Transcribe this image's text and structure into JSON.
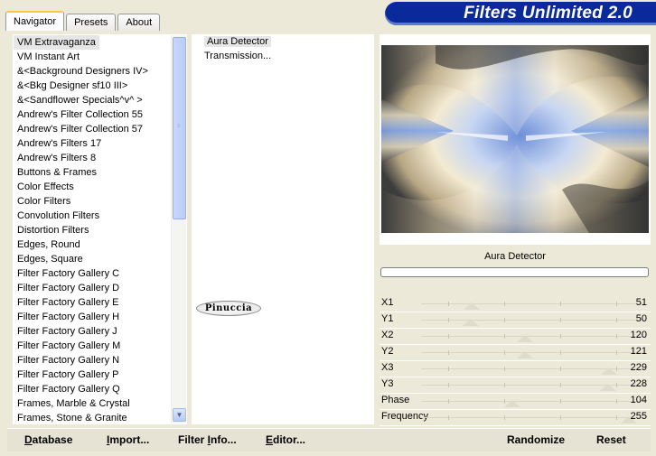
{
  "tabs": [
    {
      "label": "Navigator",
      "active": true
    },
    {
      "label": "Presets",
      "active": false
    },
    {
      "label": "About",
      "active": false
    }
  ],
  "app_title": "Filters Unlimited 2.0",
  "categories": [
    "VM Extravaganza",
    "VM Instant Art",
    "&<Background Designers IV>",
    "&<Bkg Designer sf10 III>",
    "&<Sandflower Specials^v^ >",
    "Andrew's Filter Collection 55",
    "Andrew's Filter Collection 57",
    "Andrew's Filters 17",
    "Andrew's Filters 8",
    "Buttons & Frames",
    "Color Effects",
    "Color Filters",
    "Convolution Filters",
    "Distortion Filters",
    "Edges, Round",
    "Edges, Square",
    "Filter Factory Gallery C",
    "Filter Factory Gallery D",
    "Filter Factory Gallery E",
    "Filter Factory Gallery H",
    "Filter Factory Gallery J",
    "Filter Factory Gallery M",
    "Filter Factory Gallery N",
    "Filter Factory Gallery P",
    "Filter Factory Gallery Q",
    "Frames, Marble & Crystal",
    "Frames, Stone & Granite"
  ],
  "selected_category": "VM Extravaganza",
  "filters": [
    "Aura Detector",
    "Transmission..."
  ],
  "selected_filter": "Aura Detector",
  "logo_text": "Pinuccia",
  "current_filter_name": "Aura Detector",
  "progress": 0,
  "parameters": [
    {
      "label": "X1",
      "value": 51
    },
    {
      "label": "Y1",
      "value": 50
    },
    {
      "label": "X2",
      "value": 120
    },
    {
      "label": "Y2",
      "value": 121
    },
    {
      "label": "X3",
      "value": 229
    },
    {
      "label": "Y3",
      "value": 228
    },
    {
      "label": "Phase",
      "value": 104
    },
    {
      "label": "Frequency",
      "value": 255
    }
  ],
  "parameter_max": 255,
  "buttons": {
    "database": {
      "label": "atabase",
      "hotkey": "D"
    },
    "import": {
      "label": "mport...",
      "hotkey": "I"
    },
    "filter_info": {
      "label": "Filter ",
      "hotkey": "I",
      "rest": "nfo..."
    },
    "editor": {
      "label": "ditor...",
      "hotkey": "E"
    },
    "randomize": "Randomize",
    "reset": "Reset"
  },
  "colors": {
    "banner": "#0a2a9c",
    "window_bg": "#ece9d8",
    "selection": "#e6e6e6"
  },
  "icons": {
    "scroll_up": "triangle-up",
    "scroll_down": "triangle-down"
  }
}
